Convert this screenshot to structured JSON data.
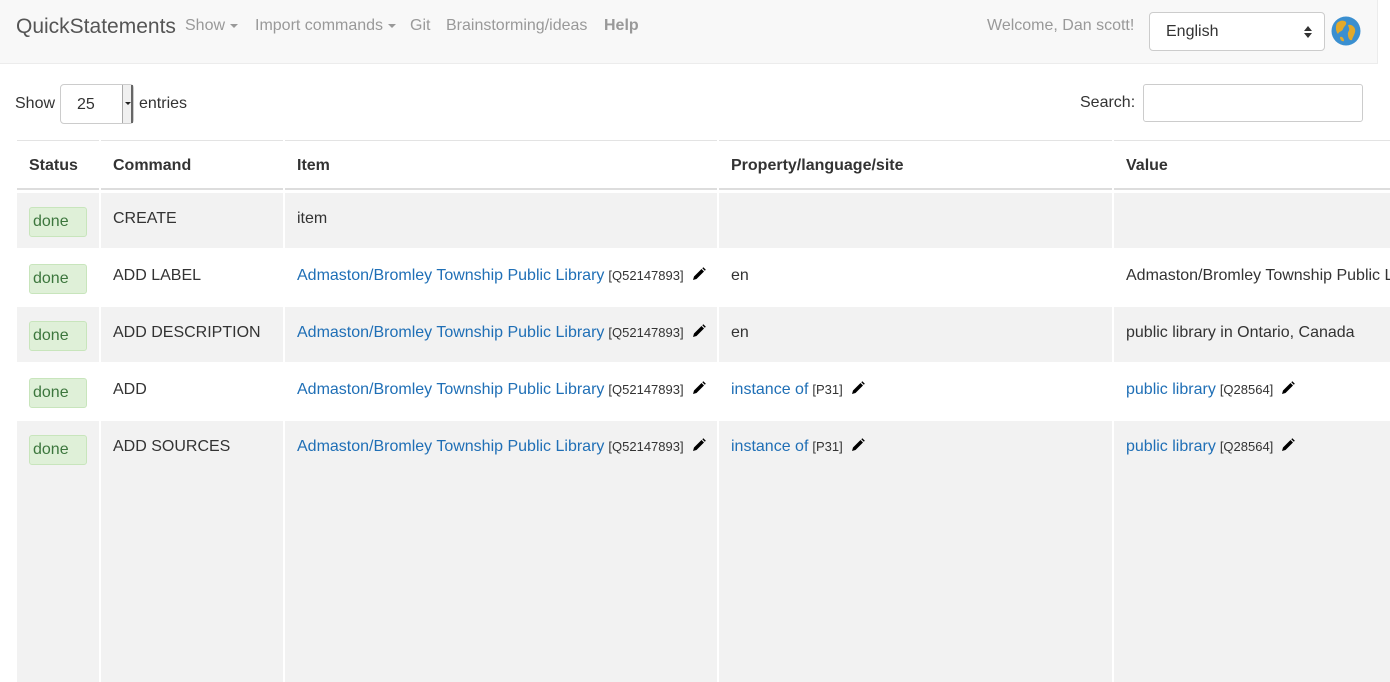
{
  "navbar": {
    "brand": "QuickStatements",
    "items": [
      {
        "label": "Show",
        "dropdown": true
      },
      {
        "label": "Import commands",
        "dropdown": true
      },
      {
        "label": "Git",
        "dropdown": false
      },
      {
        "label": "Brainstorming/ideas",
        "dropdown": false
      },
      {
        "label": "Help",
        "dropdown": false
      }
    ],
    "welcome": "Welcome, Dan scott!",
    "language": "English"
  },
  "controls": {
    "show_label": "Show",
    "entries_value": "25",
    "entries_label": "entries",
    "search_label": "Search:",
    "search_value": ""
  },
  "table": {
    "headers": [
      "Status",
      "Command",
      "Item",
      "Property/language/site",
      "Value"
    ],
    "rows": [
      {
        "status": "done",
        "command": "CREATE",
        "item": "item",
        "property": "",
        "value": ""
      },
      {
        "status": "done",
        "command": "ADD LABEL",
        "item_link": "Admaston/Bromley Township Public Library",
        "item_id": "[Q52147893]",
        "property": "en",
        "value": "Admaston/Bromley Township Public Library"
      },
      {
        "status": "done",
        "command": "ADD DESCRIPTION",
        "item_link": "Admaston/Bromley Township Public Library",
        "item_id": "[Q52147893]",
        "property": "en",
        "value": "public library in Ontario, Canada"
      },
      {
        "status": "done",
        "command": "ADD",
        "item_link": "Admaston/Bromley Township Public Library",
        "item_id": "[Q52147893]",
        "property_link": "instance of",
        "property_id": "[P31]",
        "value_link": "public library",
        "value_id": "[Q28564]"
      },
      {
        "status": "done",
        "command": "ADD SOURCES",
        "item_link": "Admaston/Bromley Township Public Library",
        "item_id": "[Q52147893]",
        "property_link": "instance of",
        "property_id": "[P31]",
        "value_link": "public library",
        "value_id": "[Q28564]"
      }
    ]
  }
}
